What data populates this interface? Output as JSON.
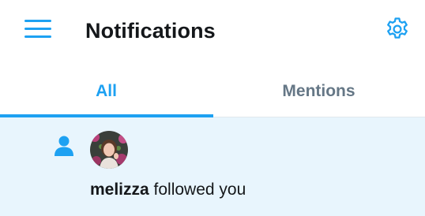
{
  "header": {
    "title": "Notifications",
    "menu_icon": "hamburger-menu-icon",
    "settings_icon": "gear-icon"
  },
  "tabs": [
    {
      "label": "All",
      "active": true
    },
    {
      "label": "Mentions",
      "active": false
    }
  ],
  "notifications": [
    {
      "type_icon": "person-icon",
      "username": "melizza",
      "action": " followed you"
    }
  ],
  "colors": {
    "accent": "#1da1f2",
    "text": "#14171a",
    "muted": "#657786",
    "unread_bg": "#e8f5fd"
  }
}
